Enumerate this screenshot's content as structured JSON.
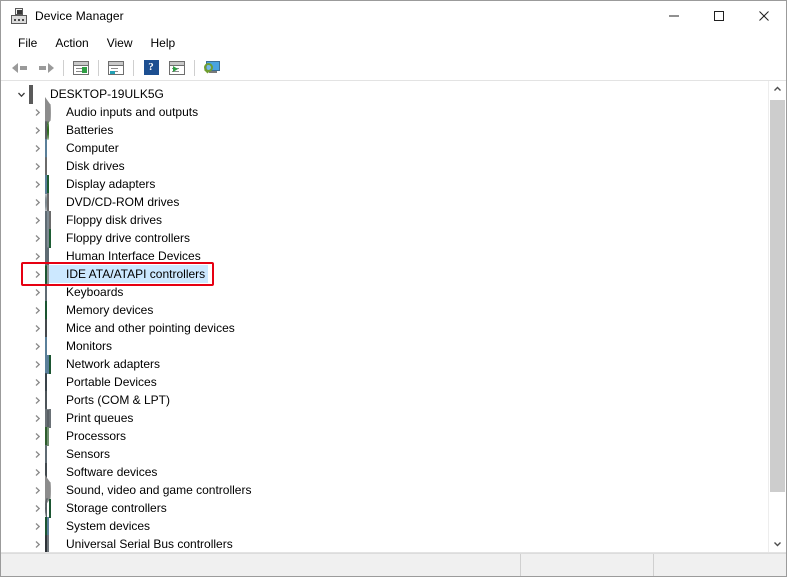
{
  "window": {
    "title": "Device Manager",
    "icon": "device-manager-icon",
    "controls": {
      "minimize": "minimize-icon",
      "maximize": "maximize-icon",
      "close": "close-icon"
    }
  },
  "menubar": {
    "items": [
      {
        "label": "File"
      },
      {
        "label": "Action"
      },
      {
        "label": "View"
      },
      {
        "label": "Help"
      }
    ]
  },
  "toolbar": {
    "buttons": [
      {
        "name": "back-button",
        "icon": "back-arrow-icon"
      },
      {
        "name": "forward-button",
        "icon": "forward-arrow-icon"
      },
      {
        "name": "separator-1",
        "icon": "separator"
      },
      {
        "name": "properties-button",
        "icon": "properties-window-icon"
      },
      {
        "name": "separator-2",
        "icon": "separator"
      },
      {
        "name": "show-hide-console-tree-button",
        "icon": "console-tree-icon"
      },
      {
        "name": "separator-3",
        "icon": "separator"
      },
      {
        "name": "help-button",
        "icon": "question-mark-icon"
      },
      {
        "name": "update-driver-button",
        "icon": "update-driver-icon"
      },
      {
        "name": "separator-4",
        "icon": "separator"
      },
      {
        "name": "scan-for-hardware-changes-button",
        "icon": "scan-monitor-magnifier-icon"
      }
    ]
  },
  "tree": {
    "root": {
      "label": "DESKTOP-19ULK5G",
      "icon": "computer-root-icon",
      "expanded": true,
      "chevron": "chevron-down-icon"
    },
    "items": [
      {
        "label": "Audio inputs and outputs",
        "icon": "speaker-icon",
        "icon_class": "ic-speaker",
        "chevron": "chevron-right-icon",
        "selected": false
      },
      {
        "label": "Batteries",
        "icon": "battery-icon",
        "icon_class": "ic-battery",
        "chevron": "chevron-right-icon",
        "selected": false
      },
      {
        "label": "Computer",
        "icon": "monitor-icon",
        "icon_class": "ic-monitor",
        "chevron": "chevron-right-icon",
        "selected": false
      },
      {
        "label": "Disk drives",
        "icon": "disk-drive-icon",
        "icon_class": "ic-disk",
        "chevron": "chevron-right-icon",
        "selected": false
      },
      {
        "label": "Display adapters",
        "icon": "display-adapter-icon",
        "icon_class": "ic-display",
        "chevron": "chevron-right-icon",
        "selected": false
      },
      {
        "label": "DVD/CD-ROM drives",
        "icon": "dvd-drive-icon",
        "icon_class": "ic-dvd",
        "chevron": "chevron-right-icon",
        "selected": false
      },
      {
        "label": "Floppy disk drives",
        "icon": "floppy-disk-icon",
        "icon_class": "ic-floppy",
        "chevron": "chevron-right-icon",
        "selected": false
      },
      {
        "label": "Floppy drive controllers",
        "icon": "floppy-controller-icon",
        "icon_class": "ic-floppyctl",
        "chevron": "chevron-right-icon",
        "selected": false
      },
      {
        "label": "Human Interface Devices",
        "icon": "keyboard-mouse-icon",
        "icon_class": "ic-hid",
        "chevron": "chevron-right-icon",
        "selected": false
      },
      {
        "label": "IDE ATA/ATAPI controllers",
        "icon": "ide-controller-icon",
        "icon_class": "ic-ide",
        "chevron": "chevron-right-icon",
        "selected": true
      },
      {
        "label": "Keyboards",
        "icon": "keyboard-icon",
        "icon_class": "ic-keyboard",
        "chevron": "chevron-right-icon",
        "selected": false
      },
      {
        "label": "Memory devices",
        "icon": "memory-module-icon",
        "icon_class": "ic-memory",
        "chevron": "chevron-right-icon",
        "selected": false
      },
      {
        "label": "Mice and other pointing devices",
        "icon": "mouse-icon",
        "icon_class": "ic-mouse",
        "chevron": "chevron-right-icon",
        "selected": false
      },
      {
        "label": "Monitors",
        "icon": "monitor-icon",
        "icon_class": "ic-monitor",
        "chevron": "chevron-right-icon",
        "selected": false
      },
      {
        "label": "Network adapters",
        "icon": "network-adapter-icon",
        "icon_class": "ic-network",
        "chevron": "chevron-right-icon",
        "selected": false
      },
      {
        "label": "Portable Devices",
        "icon": "portable-device-icon",
        "icon_class": "ic-portable",
        "chevron": "chevron-right-icon",
        "selected": false
      },
      {
        "label": "Ports (COM & LPT)",
        "icon": "port-connector-icon",
        "icon_class": "ic-port",
        "chevron": "chevron-right-icon",
        "selected": false
      },
      {
        "label": "Print queues",
        "icon": "printer-icon",
        "icon_class": "ic-printer",
        "chevron": "chevron-right-icon",
        "selected": false
      },
      {
        "label": "Processors",
        "icon": "cpu-icon",
        "icon_class": "ic-cpu",
        "chevron": "chevron-right-icon",
        "selected": false
      },
      {
        "label": "Sensors",
        "icon": "sensor-icon",
        "icon_class": "ic-sensor",
        "chevron": "chevron-right-icon",
        "selected": false
      },
      {
        "label": "Software devices",
        "icon": "software-device-icon",
        "icon_class": "ic-software",
        "chevron": "chevron-right-icon",
        "selected": false
      },
      {
        "label": "Sound, video and game controllers",
        "icon": "speaker-icon",
        "icon_class": "ic-speaker",
        "chevron": "chevron-right-icon",
        "selected": false
      },
      {
        "label": "Storage controllers",
        "icon": "storage-controller-icon",
        "icon_class": "ic-storage",
        "chevron": "chevron-right-icon",
        "selected": false
      },
      {
        "label": "System devices",
        "icon": "system-device-icon",
        "icon_class": "ic-system",
        "chevron": "chevron-right-icon",
        "selected": false
      },
      {
        "label": "Universal Serial Bus controllers",
        "icon": "usb-icon",
        "icon_class": "ic-usb",
        "chevron": "chevron-right-icon",
        "selected": false
      }
    ]
  },
  "highlight": {
    "target_label": "IDE ATA/ATAPI controllers",
    "color": "#e60012"
  },
  "scrollbar": {
    "up_arrow": "chevron-up-icon",
    "down_arrow": "chevron-down-icon",
    "thumb": "scroll-thumb"
  },
  "statusbar": {
    "main_text": "",
    "pane_two_text": "",
    "pane_three_text": ""
  }
}
